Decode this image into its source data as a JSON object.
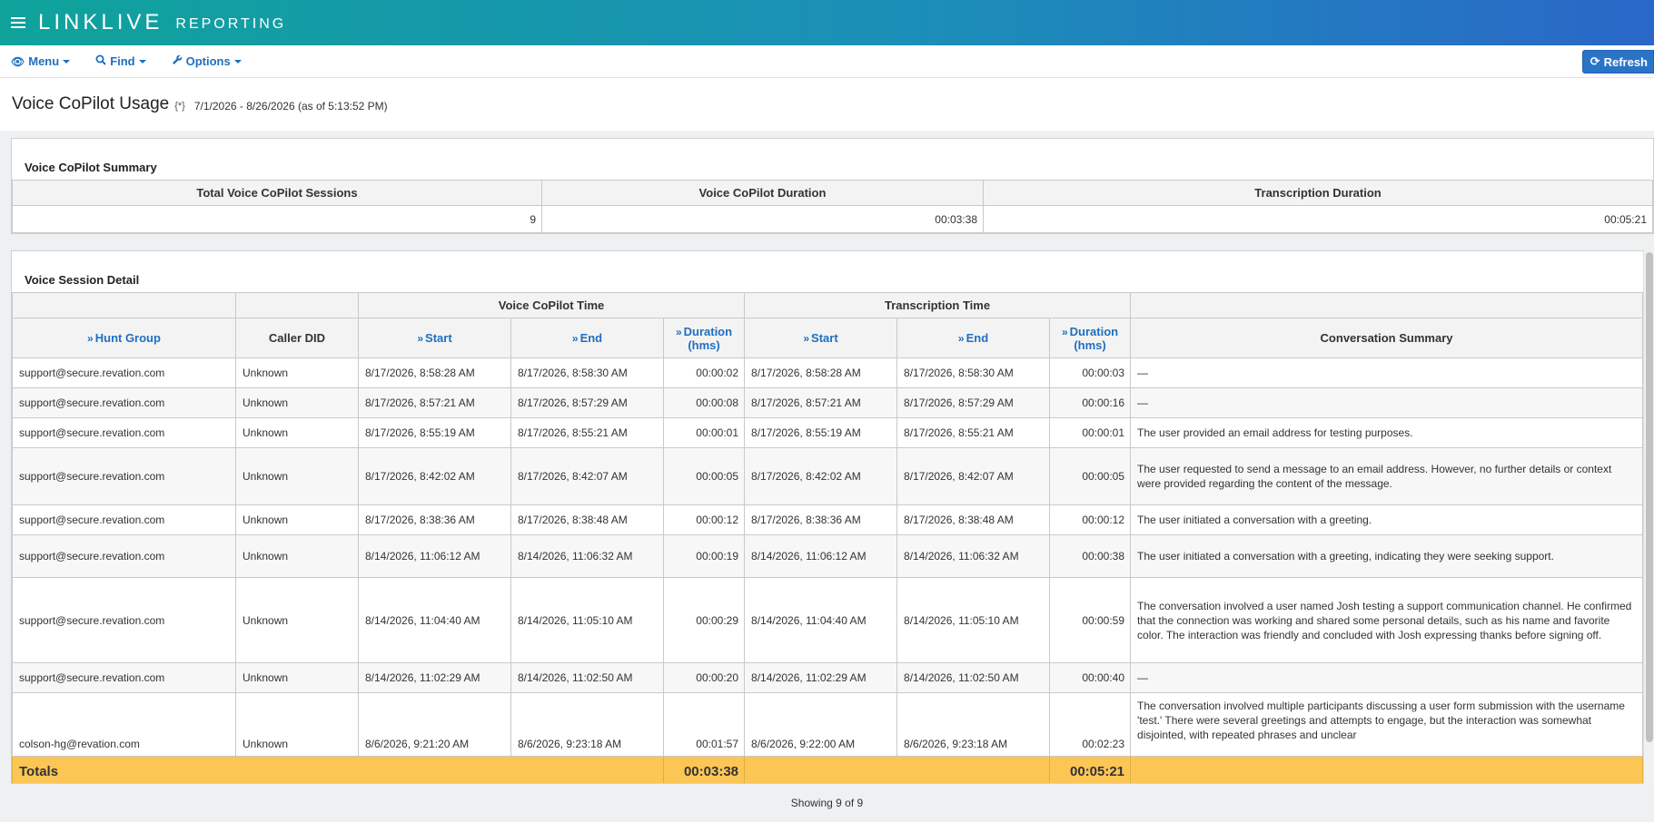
{
  "header": {
    "brand_main": "LINKLIVE",
    "brand_sub": "REPORTING"
  },
  "toolbar": {
    "menu_label": "Menu",
    "find_label": "Find",
    "options_label": "Options",
    "refresh_label": "Refresh"
  },
  "page": {
    "title": "Voice CoPilot Usage",
    "flag": "{*}",
    "range": "7/1/2026 - 8/26/2026 (as of 5:13:52 PM)"
  },
  "summary": {
    "title": "Voice CoPilot Summary",
    "headers": [
      "Total Voice CoPilot Sessions",
      "Voice CoPilot Duration",
      "Transcription Duration"
    ],
    "values": [
      "9",
      "00:03:38",
      "00:05:21"
    ]
  },
  "detail": {
    "title": "Voice Session Detail",
    "group_headers": {
      "copilot": "Voice CoPilot Time",
      "transcription": "Transcription Time"
    },
    "columns": {
      "hunt_group": "Hunt Group",
      "caller_did": "Caller DID",
      "vc_start": "Start",
      "vc_end": "End",
      "vc_duration": "Duration (hms)",
      "tr_start": "Start",
      "tr_end": "End",
      "tr_duration": "Duration (hms)",
      "summary": "Conversation Summary"
    },
    "rows": [
      {
        "hunt": "support@secure.revation.com",
        "did": "Unknown",
        "vs": "8/17/2026, 8:58:28 AM",
        "ve": "8/17/2026, 8:58:30 AM",
        "vd": "00:00:02",
        "ts": "8/17/2026, 8:58:28 AM",
        "te": "8/17/2026, 8:58:30 AM",
        "td": "00:00:03",
        "summary": "—"
      },
      {
        "hunt": "support@secure.revation.com",
        "did": "Unknown",
        "vs": "8/17/2026, 8:57:21 AM",
        "ve": "8/17/2026, 8:57:29 AM",
        "vd": "00:00:08",
        "ts": "8/17/2026, 8:57:21 AM",
        "te": "8/17/2026, 8:57:29 AM",
        "td": "00:00:16",
        "summary": "—"
      },
      {
        "hunt": "support@secure.revation.com",
        "did": "Unknown",
        "vs": "8/17/2026, 8:55:19 AM",
        "ve": "8/17/2026, 8:55:21 AM",
        "vd": "00:00:01",
        "ts": "8/17/2026, 8:55:19 AM",
        "te": "8/17/2026, 8:55:21 AM",
        "td": "00:00:01",
        "summary": "The user provided an email address for testing purposes."
      },
      {
        "hunt": "support@secure.revation.com",
        "did": "Unknown",
        "vs": "8/17/2026, 8:42:02 AM",
        "ve": "8/17/2026, 8:42:07 AM",
        "vd": "00:00:05",
        "ts": "8/17/2026, 8:42:02 AM",
        "te": "8/17/2026, 8:42:07 AM",
        "td": "00:00:05",
        "summary": "The user requested to send a message to an email address. However, no further details or context were provided regarding the content of the message."
      },
      {
        "hunt": "support@secure.revation.com",
        "did": "Unknown",
        "vs": "8/17/2026, 8:38:36 AM",
        "ve": "8/17/2026, 8:38:48 AM",
        "vd": "00:00:12",
        "ts": "8/17/2026, 8:38:36 AM",
        "te": "8/17/2026, 8:38:48 AM",
        "td": "00:00:12",
        "summary": "The user initiated a conversation with a greeting."
      },
      {
        "hunt": "support@secure.revation.com",
        "did": "Unknown",
        "vs": "8/14/2026, 11:06:12 AM",
        "ve": "8/14/2026, 11:06:32 AM",
        "vd": "00:00:19",
        "ts": "8/14/2026, 11:06:12 AM",
        "te": "8/14/2026, 11:06:32 AM",
        "td": "00:00:38",
        "summary": "The user initiated a conversation with a greeting, indicating they were seeking support."
      },
      {
        "hunt": "support@secure.revation.com",
        "did": "Unknown",
        "vs": "8/14/2026, 11:04:40 AM",
        "ve": "8/14/2026, 11:05:10 AM",
        "vd": "00:00:29",
        "ts": "8/14/2026, 11:04:40 AM",
        "te": "8/14/2026, 11:05:10 AM",
        "td": "00:00:59",
        "summary": "The conversation involved a user named Josh testing a support communication channel. He confirmed that the connection was working and shared some personal details, such as his name and favorite color. The interaction was friendly and concluded with Josh expressing thanks before signing off."
      },
      {
        "hunt": "support@secure.revation.com",
        "did": "Unknown",
        "vs": "8/14/2026, 11:02:29 AM",
        "ve": "8/14/2026, 11:02:50 AM",
        "vd": "00:00:20",
        "ts": "8/14/2026, 11:02:29 AM",
        "te": "8/14/2026, 11:02:50 AM",
        "td": "00:00:40",
        "summary": "—"
      },
      {
        "hunt": "colson-hg@revation.com",
        "did": "Unknown",
        "vs": "8/6/2026, 9:21:20 AM",
        "ve": "8/6/2026, 9:23:18 AM",
        "vd": "00:01:57",
        "ts": "8/6/2026, 9:22:00 AM",
        "te": "8/6/2026, 9:23:18 AM",
        "td": "00:02:23",
        "summary": "The conversation involved multiple participants discussing a user form submission with the username 'test.' There were several greetings and attempts to engage, but the interaction was somewhat disjointed, with repeated phrases and unclear"
      }
    ],
    "totals": {
      "label": "Totals",
      "vc_duration": "00:03:38",
      "tr_duration": "00:05:21"
    }
  },
  "footer": {
    "showing": "Showing 9 of 9"
  },
  "colors": {
    "header_start": "#0fa39b",
    "header_end": "#2a67c8",
    "link": "#1f6fc0",
    "totals_bg": "#fcc655",
    "refresh_bg": "#2a74c8"
  },
  "icons": {
    "menu": "eye-icon",
    "find": "search-icon",
    "options": "wrench-icon",
    "refresh": "refresh-icon",
    "sort": "chevron-double-right-icon"
  }
}
